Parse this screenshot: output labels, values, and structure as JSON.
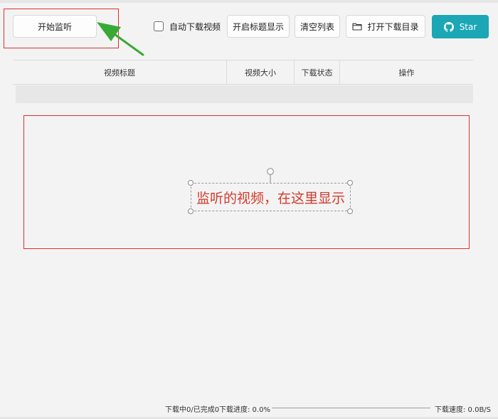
{
  "toolbar": {
    "start_listen": "开始监听",
    "auto_download": "自动下载视频",
    "toggle_title": "开启标题显示",
    "clear_list": "清空列表",
    "open_dir": "打开下载目录",
    "star": "Star"
  },
  "table": {
    "columns": [
      "视频标题",
      "视频大小",
      "下载状态",
      "操作"
    ]
  },
  "annotation": {
    "text": "监听的视频，在这里显示"
  },
  "status": {
    "downloading": "下载中0/已完成0",
    "progress_label": "下载进度: 0.0%",
    "progress_value": 0,
    "speed": "下载速度: 0.0B/S"
  },
  "icons": {
    "folder": "folder-icon",
    "github": "github-icon",
    "arrow": "green-arrow-icon"
  },
  "colors": {
    "accent": "#1ba7b5",
    "annotation_red": "#e03030",
    "arrow_green": "#39a935"
  }
}
